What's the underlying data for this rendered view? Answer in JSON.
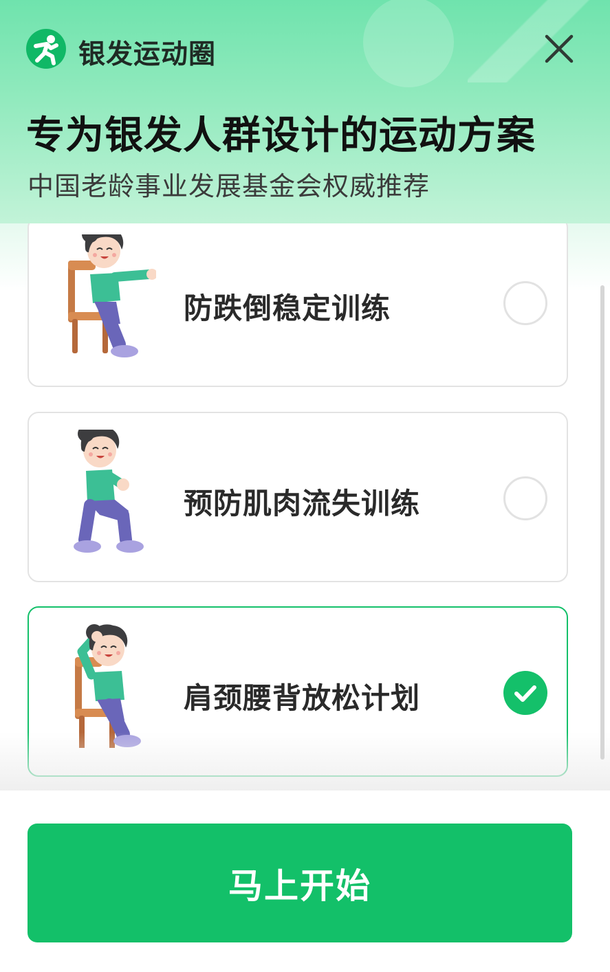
{
  "header": {
    "app_name": "银发运动圈",
    "logo_icon": "running-person-icon",
    "close_icon": "close-icon",
    "title": "专为银发人群设计的运动方案",
    "subtitle": "中国老龄事业发展基金会权威推荐"
  },
  "plans": [
    {
      "label": "防跌倒稳定训练",
      "selected": false,
      "figure_icon": "seated-arms-forward-exercise-icon"
    },
    {
      "label": "预防肌肉流失训练",
      "selected": false,
      "figure_icon": "squat-exercise-icon"
    },
    {
      "label": "肩颈腰背放松计划",
      "selected": true,
      "figure_icon": "seated-neck-stretch-exercise-icon"
    }
  ],
  "footer": {
    "start_label": "马上开始"
  },
  "colors": {
    "brand_green": "#13c069",
    "header_gradient_top": "#6fe3ad",
    "text_dark": "#111111"
  }
}
